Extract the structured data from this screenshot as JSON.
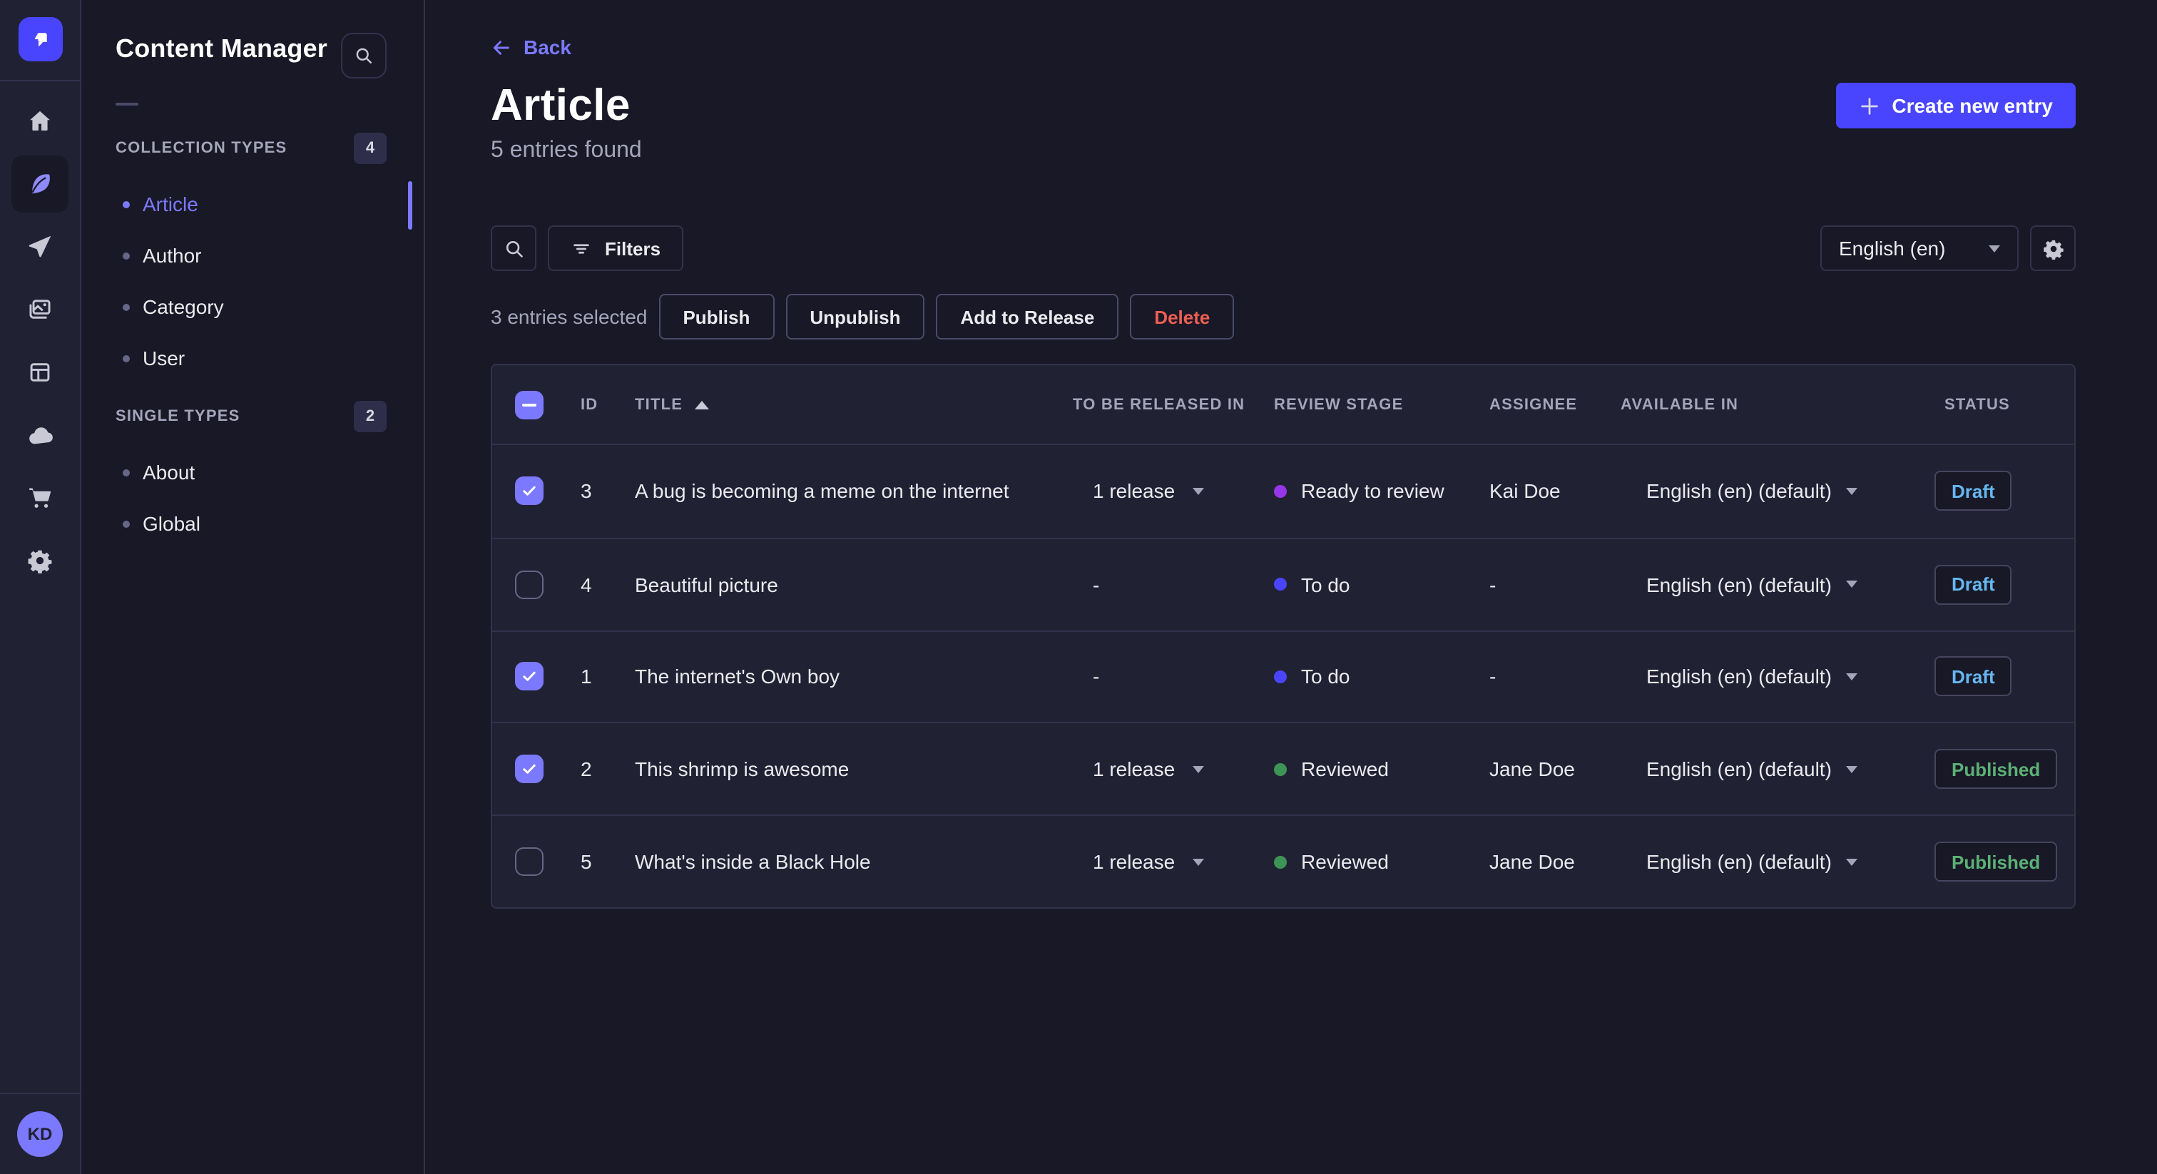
{
  "colors": {
    "primary": "#4945ff",
    "purple": "#7b79ff",
    "danger": "#ee5e52",
    "draft": "#66b7f1",
    "published": "#5cb176"
  },
  "nav": {
    "logo_icon": "strapi-logo",
    "items": [
      {
        "icon": "home-icon"
      },
      {
        "icon": "feather-icon",
        "active": true
      },
      {
        "icon": "paper-plane-icon"
      },
      {
        "icon": "images-icon"
      },
      {
        "icon": "layout-icon"
      },
      {
        "icon": "cloud-icon"
      },
      {
        "icon": "cart-icon"
      },
      {
        "icon": "gear-icon"
      }
    ],
    "avatar_initials": "KD"
  },
  "subnav": {
    "title": "Content Manager",
    "search_icon": "search-icon",
    "sections": [
      {
        "label": "COLLECTION TYPES",
        "count": "4",
        "items": [
          {
            "label": "Article",
            "active": true
          },
          {
            "label": "Author"
          },
          {
            "label": "Category"
          },
          {
            "label": "User"
          }
        ]
      },
      {
        "label": "SINGLE TYPES",
        "count": "2",
        "items": [
          {
            "label": "About"
          },
          {
            "label": "Global"
          }
        ]
      }
    ]
  },
  "header": {
    "back_label": "Back",
    "title": "Article",
    "subtitle": "5 entries found",
    "create_button": "Create new entry"
  },
  "toolbar": {
    "filters_label": "Filters",
    "locale": "English (en)"
  },
  "selection": {
    "text": "3 entries selected",
    "actions": [
      {
        "label": "Publish"
      },
      {
        "label": "Unpublish"
      },
      {
        "label": "Add to Release"
      },
      {
        "label": "Delete",
        "danger": true
      }
    ]
  },
  "table": {
    "columns": [
      "ID",
      "TITLE",
      "TO BE RELEASED IN",
      "REVIEW STAGE",
      "ASSIGNEE",
      "AVAILABLE IN",
      "STATUS"
    ],
    "sorted_column": "TITLE",
    "sort_direction": "asc",
    "status_colors": {
      "Draft": "#66b7f1",
      "Published": "#5cb176"
    },
    "rows": [
      {
        "checked": true,
        "id": "3",
        "title": "A bug is becoming a meme on the internet",
        "release": "1 release",
        "stage": "Ready to review",
        "stage_color": "#9736e8",
        "assignee": "Kai Doe",
        "locale": "English (en) (default)",
        "status": "Draft"
      },
      {
        "checked": false,
        "id": "4",
        "title": "Beautiful picture",
        "release": "-",
        "stage": "To do",
        "stage_color": "#4945ff",
        "assignee": "-",
        "locale": "English (en) (default)",
        "status": "Draft"
      },
      {
        "checked": true,
        "id": "1",
        "title": "The internet's Own boy",
        "release": "-",
        "stage": "To do",
        "stage_color": "#4945ff",
        "assignee": "-",
        "locale": "English (en) (default)",
        "status": "Draft"
      },
      {
        "checked": true,
        "id": "2",
        "title": "This shrimp is awesome",
        "release": "1 release",
        "stage": "Reviewed",
        "stage_color": "#3d9455",
        "assignee": "Jane Doe",
        "locale": "English (en) (default)",
        "status": "Published"
      },
      {
        "checked": false,
        "id": "5",
        "title": "What's inside a Black Hole",
        "release": "1 release",
        "stage": "Reviewed",
        "stage_color": "#3d9455",
        "assignee": "Jane Doe",
        "locale": "English (en) (default)",
        "status": "Published"
      }
    ]
  }
}
